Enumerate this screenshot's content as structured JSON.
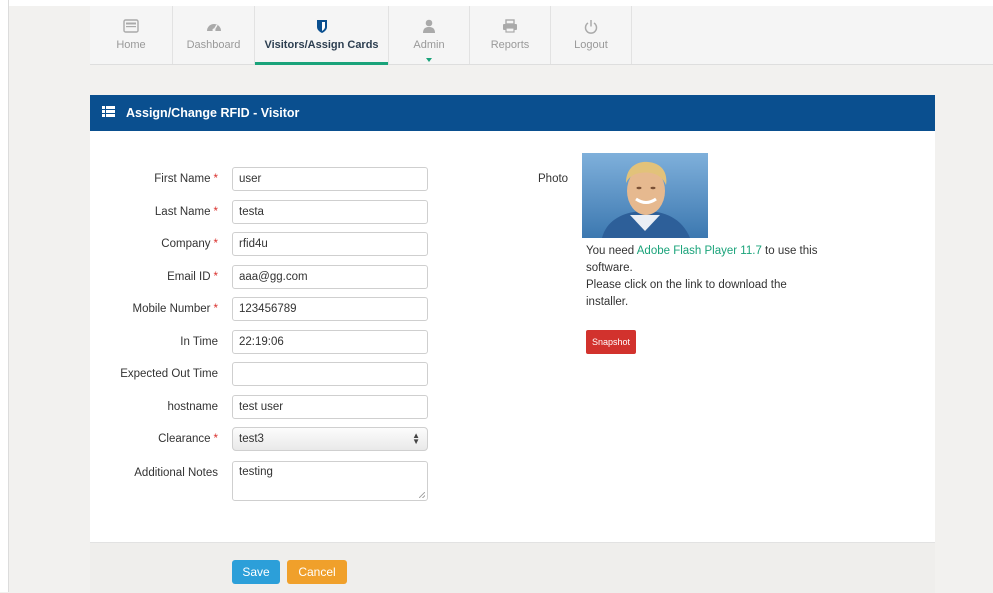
{
  "nav": {
    "items": [
      {
        "label": "Home",
        "icon": "home-icon"
      },
      {
        "label": "Dashboard",
        "icon": "dashboard-icon"
      },
      {
        "label": "Visitors/Assign Cards",
        "icon": "shield-icon"
      },
      {
        "label": "Admin",
        "icon": "user-icon"
      },
      {
        "label": "Reports",
        "icon": "printer-icon"
      },
      {
        "label": "Logout",
        "icon": "power-icon"
      }
    ],
    "active": "Visitors/Assign Cards",
    "accent": "#1aa37a"
  },
  "panel": {
    "title": "Assign/Change RFID - Visitor",
    "header_color": "#0a4f8f"
  },
  "form": {
    "first_name": {
      "label": "First Name",
      "value": "user"
    },
    "last_name": {
      "label": "Last Name",
      "value": "testa"
    },
    "company": {
      "label": "Company",
      "value": "rfid4u"
    },
    "email": {
      "label": "Email ID",
      "value": "aaa@gg.com"
    },
    "mobile": {
      "label": "Mobile Number",
      "value": "123456789"
    },
    "in_time": {
      "label": "In Time",
      "value": "22:19:06"
    },
    "expected_out": {
      "label": "Expected Out Time",
      "value": ""
    },
    "hostname": {
      "label": "hostname",
      "value": "test user"
    },
    "clearance": {
      "label": "Clearance",
      "value": "test3"
    },
    "notes": {
      "label": "Additional Notes",
      "value": "testing"
    },
    "required_mark": "*"
  },
  "photo": {
    "label": "Photo",
    "flash_prefix": "You need ",
    "flash_link": "Adobe Flash Player 11.7",
    "flash_suffix": " to use this software.",
    "flash_line2": "Please click on the link to download the installer.",
    "snapshot_label": "Snapshot"
  },
  "actions": {
    "save": "Save",
    "cancel": "Cancel"
  }
}
